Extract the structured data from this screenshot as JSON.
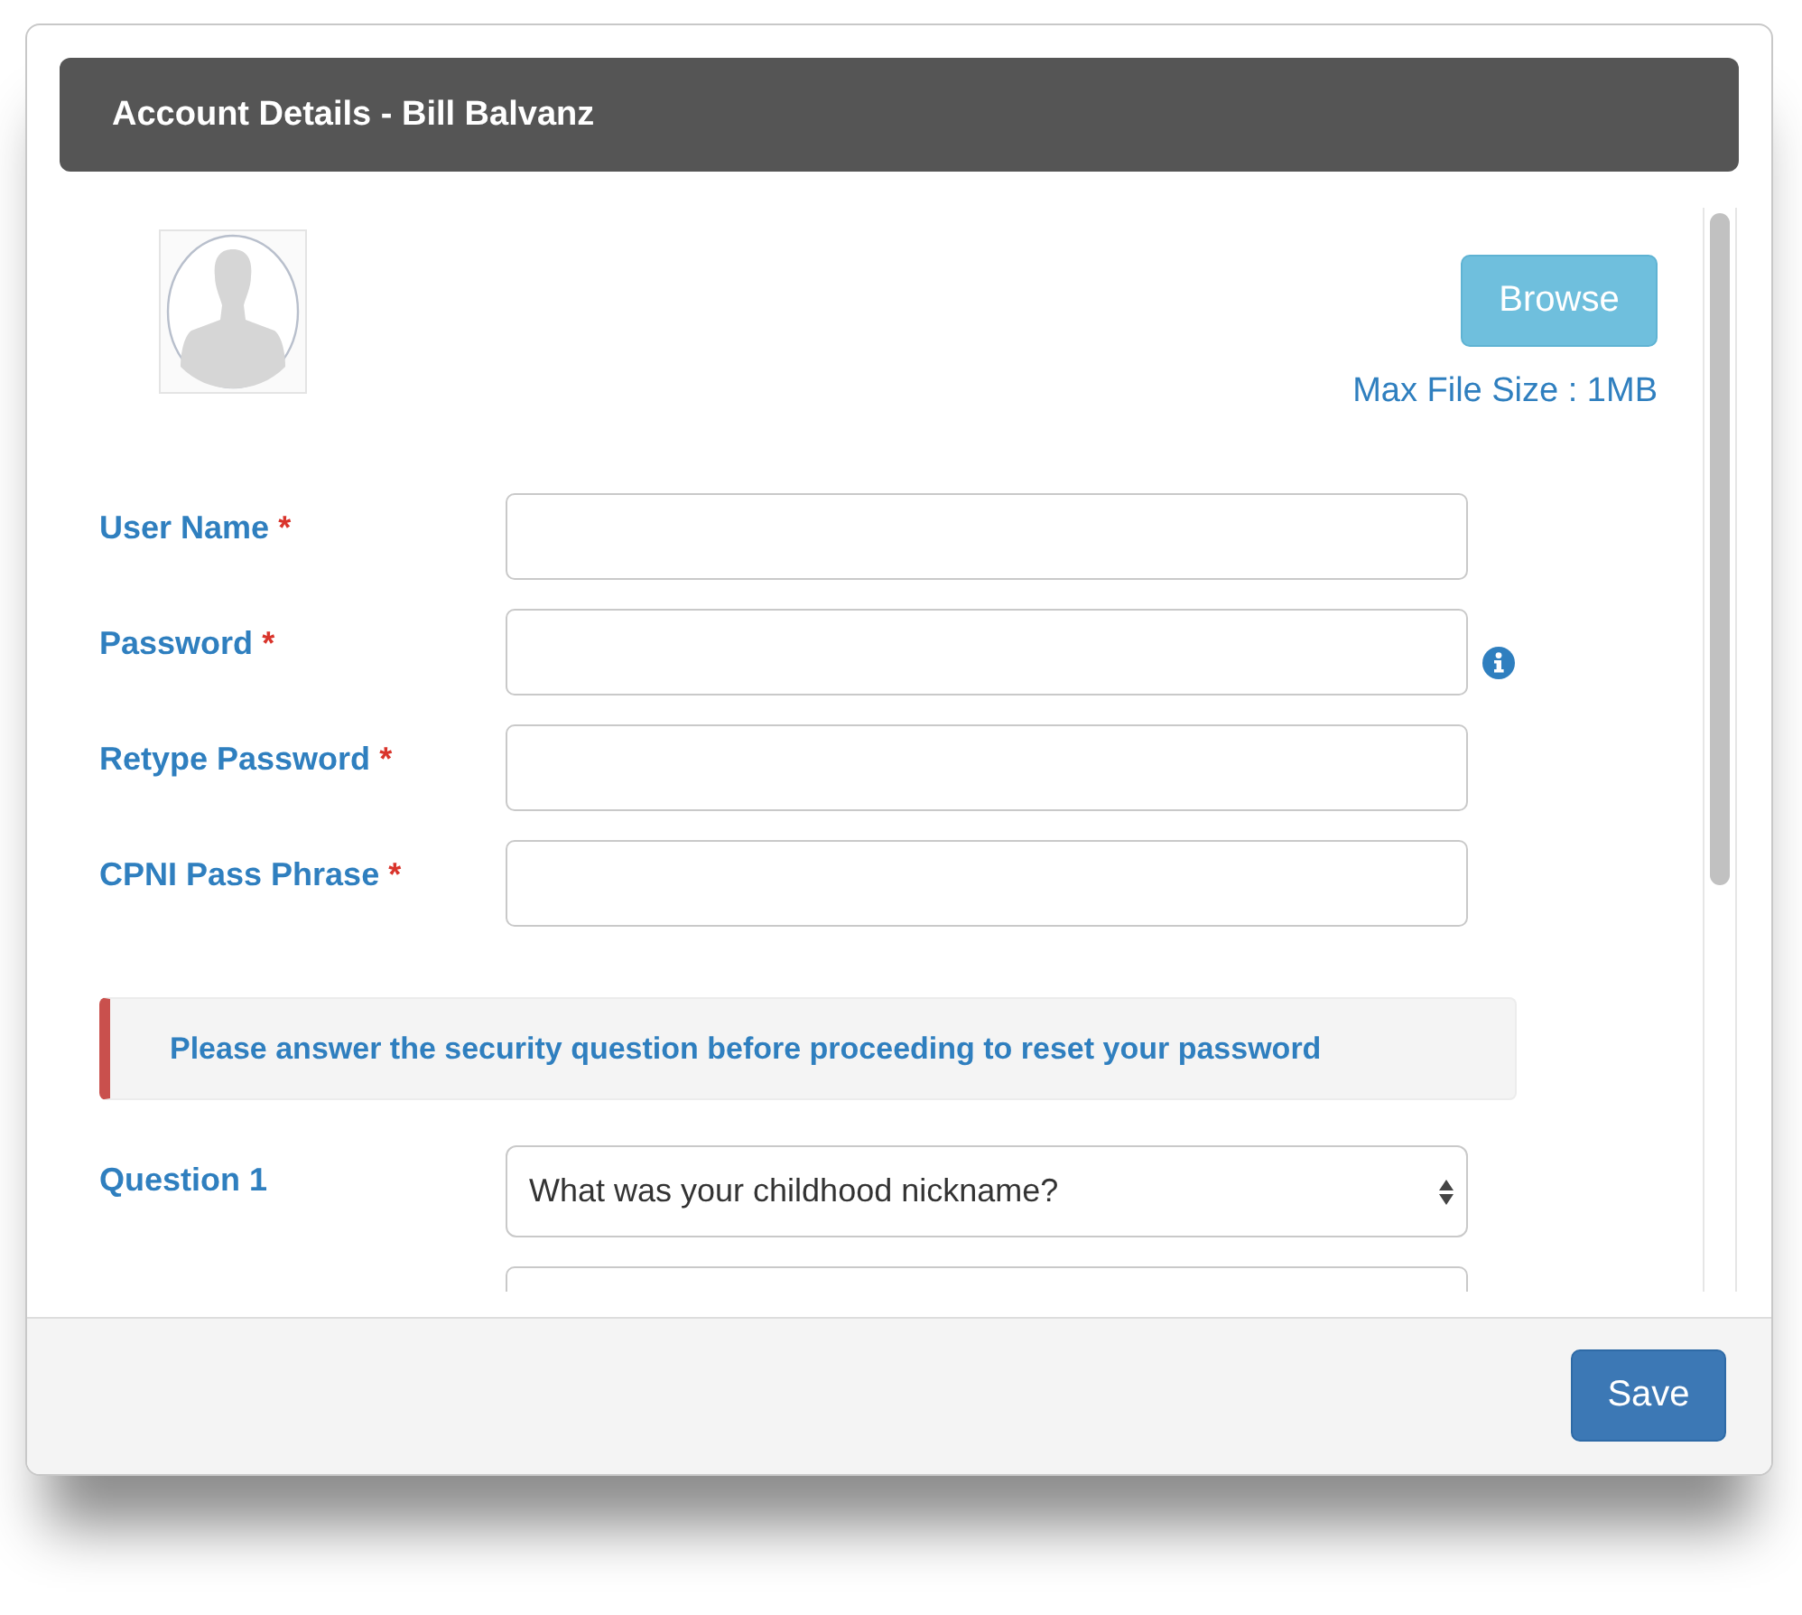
{
  "modal": {
    "title": "Account Details - Bill Balvanz"
  },
  "upload": {
    "button": "Browse",
    "note": "Max File Size : 1MB"
  },
  "fields": [
    {
      "label": "User Name",
      "required_mark": "*",
      "info": false
    },
    {
      "label": "Password",
      "required_mark": "*",
      "info": true
    },
    {
      "label": "Retype Password",
      "required_mark": "*",
      "info": false
    },
    {
      "label": "CPNI Pass Phrase",
      "required_mark": "*",
      "info": false
    }
  ],
  "alert": {
    "text": "Please answer the security question before proceeding to reset your password"
  },
  "security": [
    {
      "kind": "select",
      "label": "Question 1",
      "value": "What was your childhood nickname?"
    },
    {
      "kind": "input"
    }
  ],
  "footer": {
    "save_button": "Save"
  }
}
